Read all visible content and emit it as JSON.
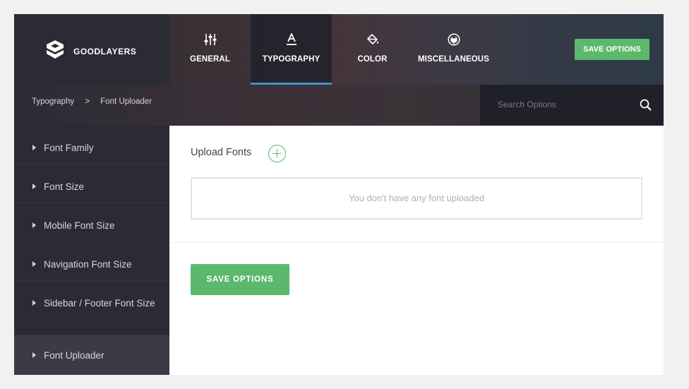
{
  "brand": {
    "name": "GOODLAYERS",
    "logo_icon": "goodlayers-logo-icon"
  },
  "tabs": [
    {
      "label": "GENERAL",
      "icon": "sliders-icon"
    },
    {
      "label": "TYPOGRAPHY",
      "icon": "font-icon",
      "active": true
    },
    {
      "label": "COLOR",
      "icon": "paint-bucket-icon"
    },
    {
      "label": "MISCELLANEOUS",
      "icon": "plug-icon"
    }
  ],
  "header": {
    "save_label": "SAVE OPTIONS"
  },
  "breadcrumb": {
    "parent": "Typography",
    "separator": ">",
    "current": "Font Uploader"
  },
  "search": {
    "placeholder": "Search Options",
    "value": ""
  },
  "sidebar": {
    "items": [
      {
        "label": "Font Family"
      },
      {
        "label": "Font Size"
      },
      {
        "label": "Mobile Font Size"
      },
      {
        "label": "Navigation Font Size"
      },
      {
        "label": "Sidebar / Footer Font Size"
      },
      {
        "label": "Font Uploader",
        "active": true
      }
    ]
  },
  "main": {
    "upload_label": "Upload Fonts",
    "empty_message": "You don't have any font uploaded",
    "save_label": "SAVE OPTIONS"
  },
  "colors": {
    "accent_green": "#5cb86c",
    "active_tab_underline": "#3d95d1",
    "sidebar_bg": "#2a2b35"
  }
}
